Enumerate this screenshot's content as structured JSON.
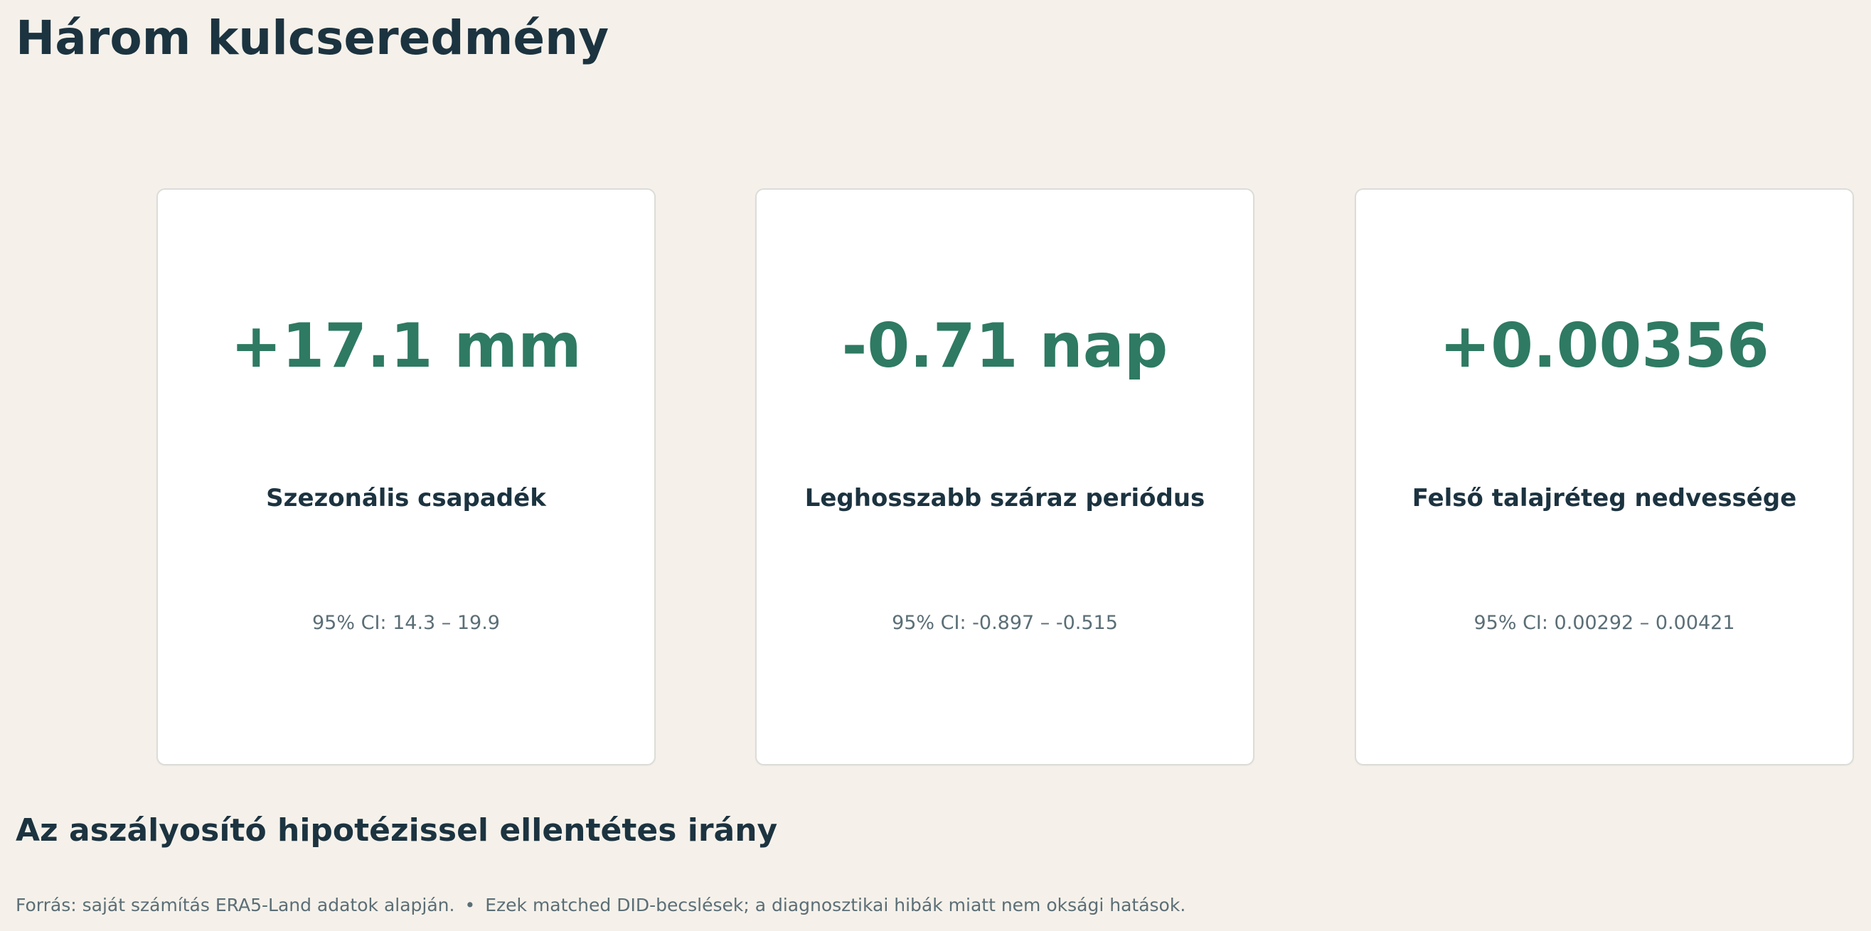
{
  "page": {
    "title": "Három kulcseredmény",
    "subtitle": "Az aszályosító hipotézissel ellentétes irány"
  },
  "cards": [
    {
      "value": "+17.1 mm",
      "label": "Szezonális csapadék",
      "ci": "95% CI: 14.3 – 19.9"
    },
    {
      "value": "-0.71 nap",
      "label": "Leghosszabb száraz periódus",
      "ci": "95% CI: -0.897 – -0.515"
    },
    {
      "value": "+0.00356",
      "label": "Felső talajréteg nedvessége",
      "ci": "95% CI: 0.00292 – 0.00421"
    }
  ],
  "footer": {
    "source": "Forrás: saját számítás ERA5-Land adatok alapján.",
    "separator": "•",
    "note": "Ezek matched DID-becslések; a diagnosztikai hibák miatt nem oksági hatások."
  },
  "colors": {
    "background": "#f5f1ea",
    "accent": "#2e7a62",
    "heading": "#1c3340",
    "muted": "#5b6e76"
  }
}
